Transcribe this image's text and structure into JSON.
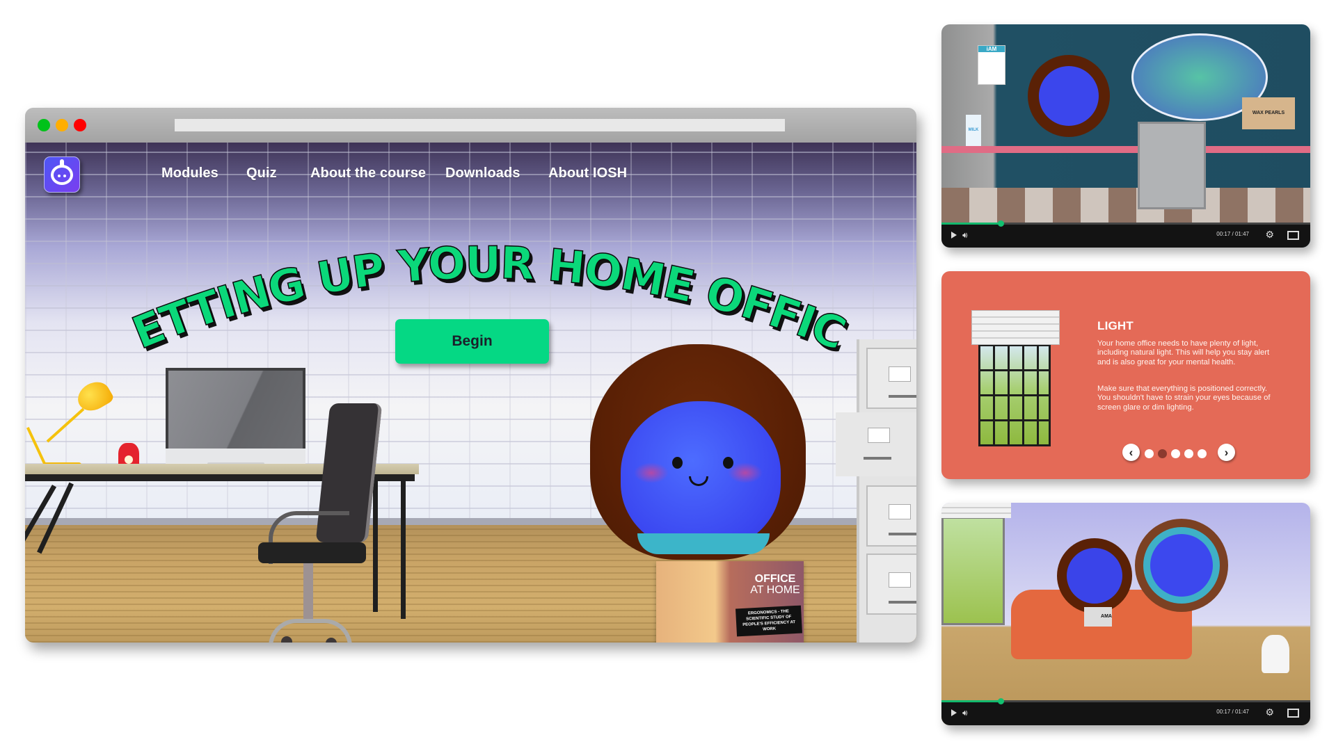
{
  "browser": {
    "window_controls": [
      {
        "name": "close",
        "color": "#00c21a"
      },
      {
        "name": "minimize",
        "color": "#ffae00"
      },
      {
        "name": "maximize",
        "color": "#ff0000"
      }
    ]
  },
  "site": {
    "logo": "iam-robot-logo",
    "nav": [
      {
        "label": "Modules"
      },
      {
        "label": "Quiz"
      },
      {
        "label": "About the course"
      },
      {
        "label": "Downloads"
      },
      {
        "label": "About IOSH"
      }
    ],
    "hero_title": "SETTING UP YOUR HOME OFFICE",
    "begin_label": "Begin",
    "accent_color": "#05d884",
    "magazine": {
      "title_line1": "OFFICE",
      "title_line2": "AT HOME",
      "subtitle": "ERGONOMICS - THE SCIENTIFIC STUDY OF PEOPLE'S EFFICIENCY AT WORK"
    }
  },
  "video1": {
    "scene_label": "WAX PEARLS",
    "poster_label": "iAM",
    "milk_label": "MILK",
    "time": "00:17 / 01:47",
    "progress_fraction": 0.16
  },
  "slide": {
    "title": "LIGHT",
    "paragraphs": [
      "Your home office needs to have plenty of light, including natural light. This will help you stay alert and is also great for your mental health.",
      "Make sure that everything is positioned correctly. You shouldn't have to strain your eyes because of screen glare or dim lighting."
    ],
    "prev_icon": "‹",
    "next_icon": "›",
    "page_count": 5,
    "current_page": 1,
    "bg_color": "#e46a57",
    "active_dot_color": "#8b3a2f"
  },
  "video3": {
    "shirt_label": "AMA",
    "time": "00:17 / 01:47",
    "progress_fraction": 0.16
  }
}
